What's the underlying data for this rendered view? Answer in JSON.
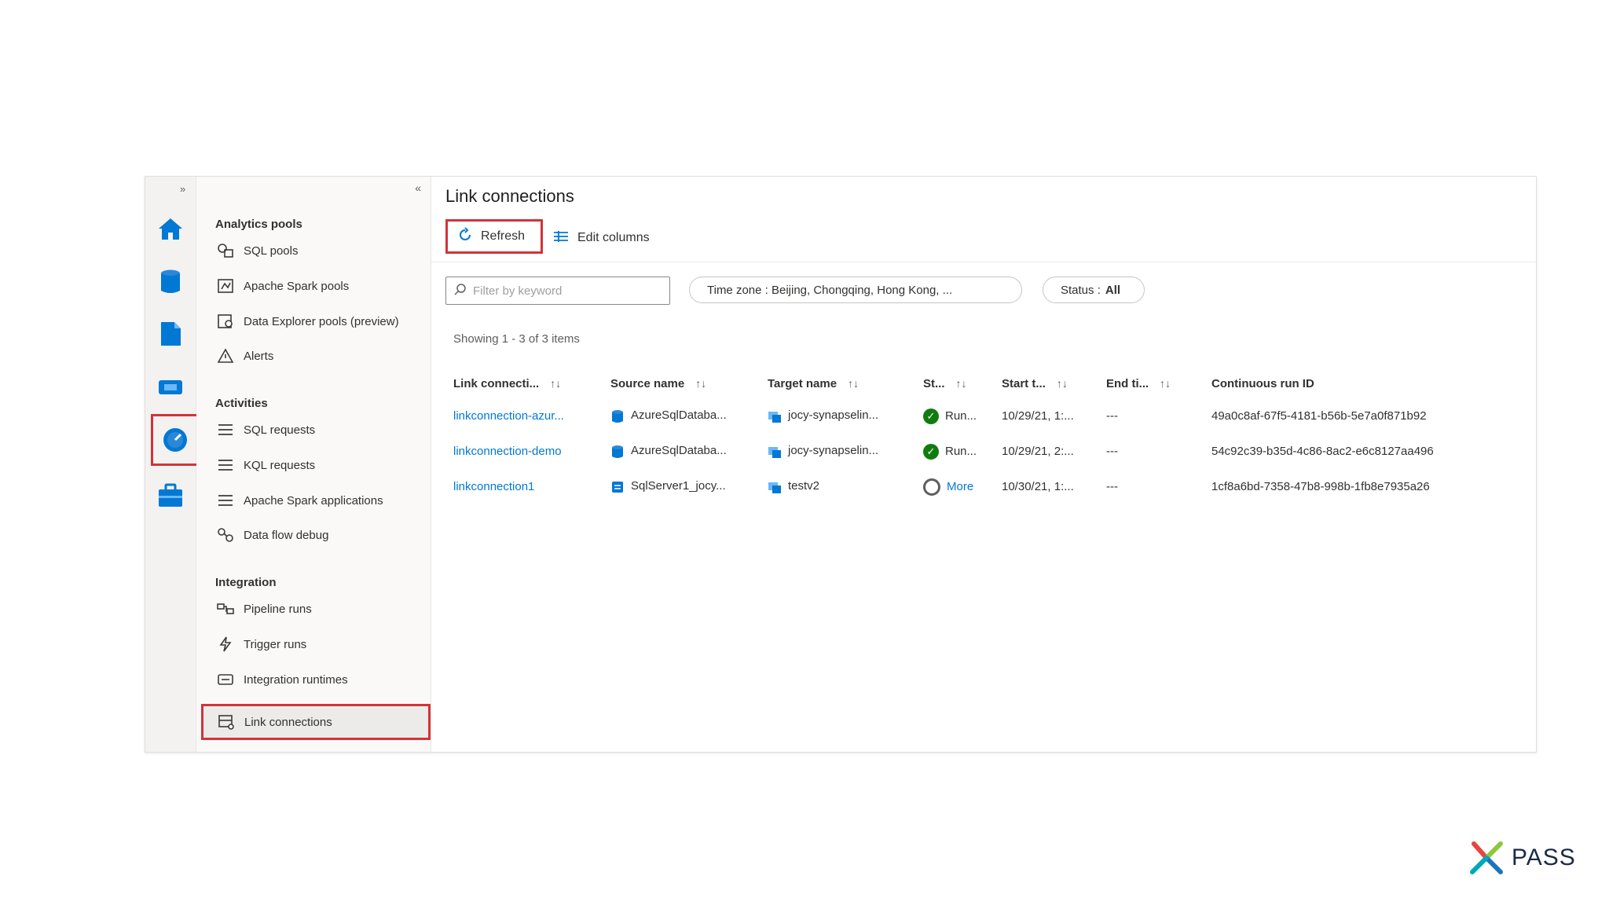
{
  "rail": {
    "expand_glyph": "»",
    "items": [
      {
        "icon": "home-icon"
      },
      {
        "icon": "data-icon"
      },
      {
        "icon": "develop-icon"
      },
      {
        "icon": "integrate-icon"
      },
      {
        "icon": "monitor-icon",
        "selected": true
      },
      {
        "icon": "manage-icon"
      }
    ]
  },
  "menu": {
    "collapse_glyph": "«",
    "sections": [
      {
        "title": "Analytics pools",
        "items": [
          "SQL pools",
          "Apache Spark pools",
          "Data Explorer pools (preview)",
          "Alerts"
        ]
      },
      {
        "title": "Activities",
        "items": [
          "SQL requests",
          "KQL requests",
          "Apache Spark applications",
          "Data flow debug"
        ]
      },
      {
        "title": "Integration",
        "items": [
          "Pipeline runs",
          "Trigger runs",
          "Integration runtimes",
          "Link connections"
        ]
      }
    ],
    "active_item": "Link connections"
  },
  "main": {
    "title": "Link connections",
    "toolbar": {
      "refresh_label": "Refresh",
      "edit_columns_label": "Edit columns"
    },
    "filter": {
      "placeholder": "Filter by keyword"
    },
    "timezone_pill": "Time zone : Beijing, Chongqing, Hong Kong, ...",
    "status_pill": {
      "label": "Status :",
      "value": "All"
    },
    "showing": "Showing 1 - 3 of 3 items",
    "columns": [
      "Link connecti...",
      "Source name",
      "Target name",
      "St...",
      "Start t...",
      "End ti...",
      "Continuous run ID"
    ],
    "rows": [
      {
        "link": "linkconnection-azur...",
        "source": "AzureSqlDataba...",
        "target": "jocy-synapselin...",
        "status": "Run...",
        "status_kind": "running",
        "start": "10/29/21, 1:...",
        "end": "---",
        "run_id": "49a0c8af-67f5-4181-b56b-5e7a0f871b92"
      },
      {
        "link": "linkconnection-demo",
        "source": "AzureSqlDataba...",
        "target": "jocy-synapselin...",
        "status": "Run...",
        "status_kind": "running",
        "start": "10/29/21, 2:...",
        "end": "---",
        "run_id": "54c92c39-b35d-4c86-8ac2-e6c8127aa496"
      },
      {
        "link": "linkconnection1",
        "source": "SqlServer1_jocy...",
        "target": "testv2",
        "status": "More",
        "status_kind": "stopped",
        "start": "10/30/21, 1:...",
        "end": "---",
        "run_id": "1cf8a6bd-7358-47b8-998b-1fb8e7935a26"
      }
    ]
  },
  "logo": {
    "text": "PASS"
  },
  "colors": {
    "accent": "#0078d4",
    "highlight": "#d13438",
    "success": "#107c10"
  }
}
